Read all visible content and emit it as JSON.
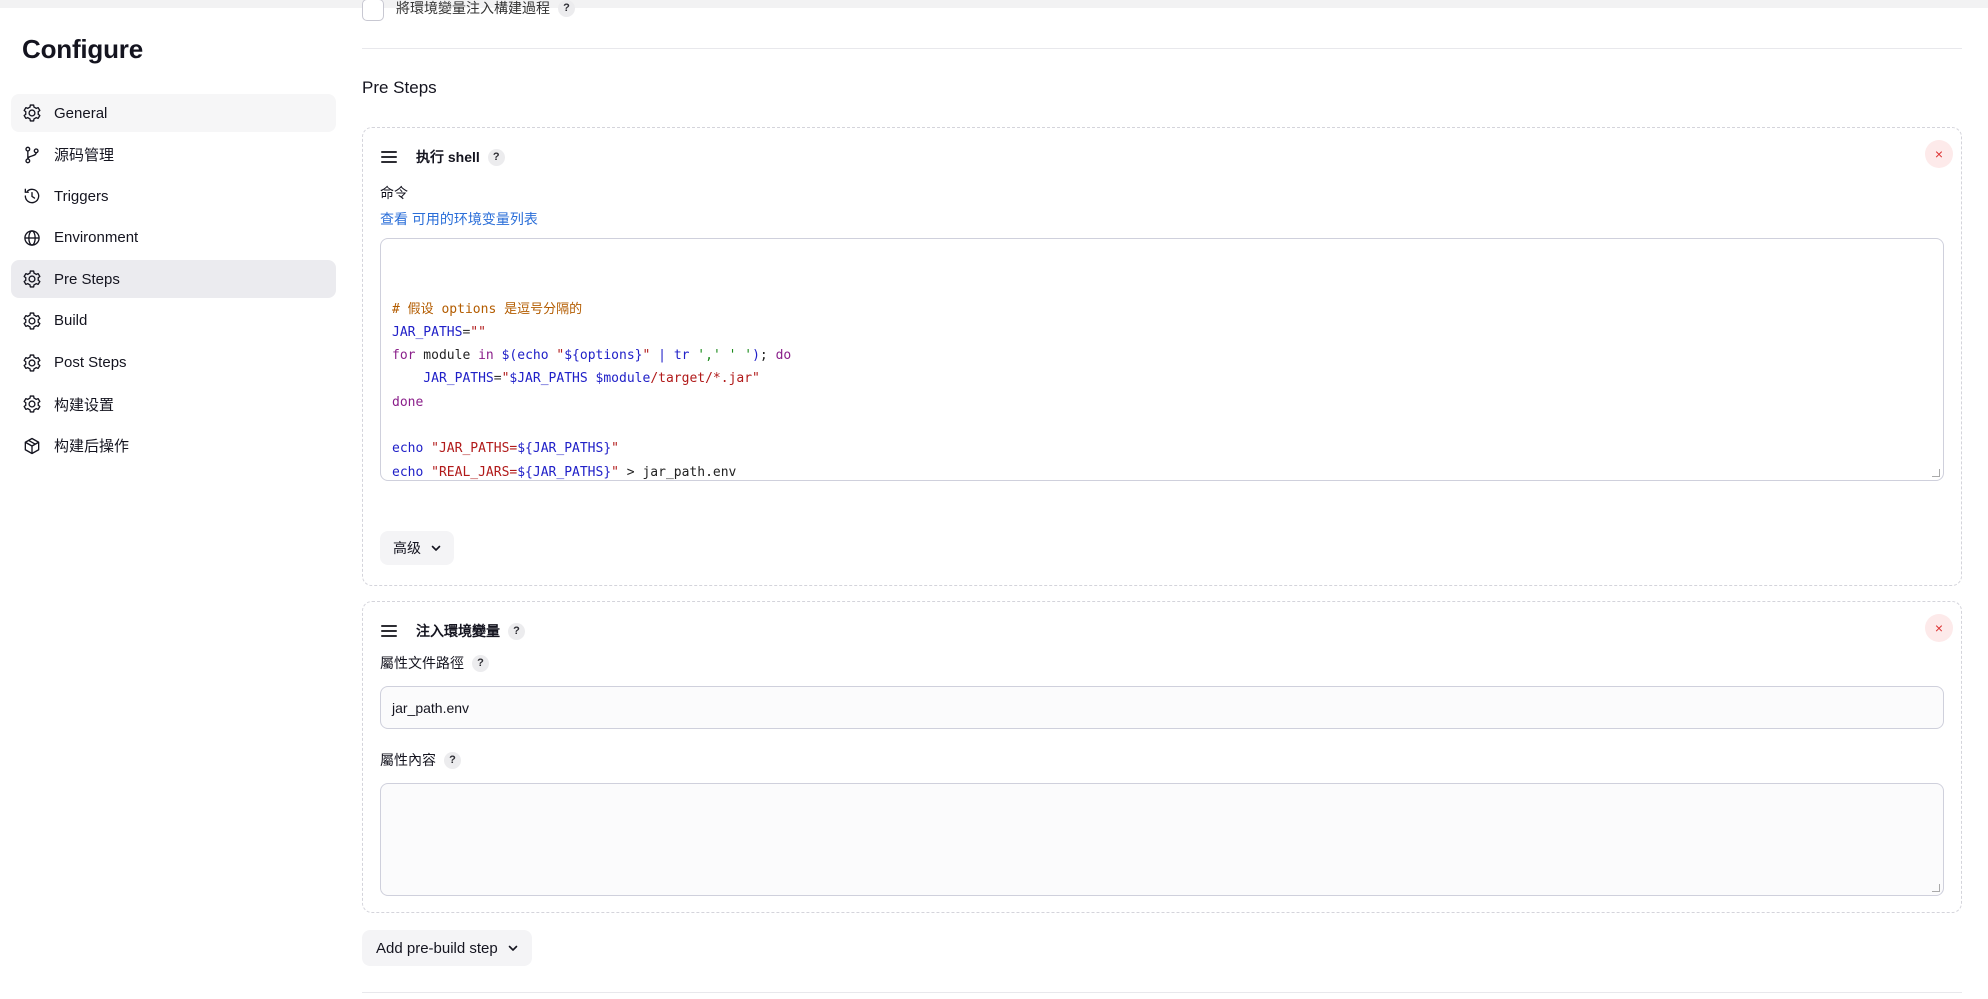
{
  "page": {
    "title": "Configure"
  },
  "sidebar": {
    "items": [
      {
        "label": "General",
        "icon": "gear-icon",
        "state": "hovered"
      },
      {
        "label": "源码管理",
        "icon": "source-branch-icon",
        "state": ""
      },
      {
        "label": "Triggers",
        "icon": "clock-icon",
        "state": ""
      },
      {
        "label": "Environment",
        "icon": "globe-icon",
        "state": ""
      },
      {
        "label": "Pre Steps",
        "icon": "gear-icon",
        "state": "active"
      },
      {
        "label": "Build",
        "icon": "gear-icon",
        "state": ""
      },
      {
        "label": "Post Steps",
        "icon": "gear-icon",
        "state": ""
      },
      {
        "label": "构建设置",
        "icon": "gear-icon",
        "state": ""
      },
      {
        "label": "构建后操作",
        "icon": "package-icon",
        "state": ""
      }
    ]
  },
  "top_option": {
    "label": "將環境變量注入構建過程",
    "help": "?"
  },
  "section": {
    "title": "Pre Steps"
  },
  "step1": {
    "title": "执行 shell",
    "help": "?",
    "close": "×",
    "command_label": "命令",
    "link_prefix": "查看 ",
    "link_text": "可用的环境变量列表",
    "code_lines": [
      [
        {
          "t": "# 假设 options 是逗号分隔的",
          "c": "#b35c00"
        }
      ],
      [
        {
          "t": "JAR_PATHS",
          "c": "#2020c8"
        },
        {
          "t": "=",
          "c": "#333"
        },
        {
          "t": "\"\"",
          "c": "#b11a1a"
        }
      ],
      [
        {
          "t": "for",
          "c": "#8a1f8a"
        },
        {
          "t": " module ",
          "c": "#222"
        },
        {
          "t": "in",
          "c": "#8a1f8a"
        },
        {
          "t": " ",
          "c": "#222"
        },
        {
          "t": "$(",
          "c": "#2020c8"
        },
        {
          "t": "echo ",
          "c": "#2020c8"
        },
        {
          "t": "\"",
          "c": "#b11a1a"
        },
        {
          "t": "${options}",
          "c": "#2020c8"
        },
        {
          "t": "\"",
          "c": "#b11a1a"
        },
        {
          "t": " | ",
          "c": "#2020c8"
        },
        {
          "t": "tr ",
          "c": "#2020c8"
        },
        {
          "t": "','",
          "c": "#1b8a1b"
        },
        {
          "t": " ",
          "c": "#222"
        },
        {
          "t": "' '",
          "c": "#1b8a1b"
        },
        {
          "t": ")",
          "c": "#2020c8"
        },
        {
          "t": "; ",
          "c": "#222"
        },
        {
          "t": "do",
          "c": "#8a1f8a"
        }
      ],
      [
        {
          "t": "    JAR_PATHS",
          "c": "#2020c8"
        },
        {
          "t": "=",
          "c": "#333"
        },
        {
          "t": "\"",
          "c": "#b11a1a"
        },
        {
          "t": "$JAR_PATHS",
          "c": "#2020c8"
        },
        {
          "t": " ",
          "c": "#b11a1a"
        },
        {
          "t": "$module",
          "c": "#2020c8"
        },
        {
          "t": "/target/*.jar\"",
          "c": "#b11a1a"
        }
      ],
      [
        {
          "t": "done",
          "c": "#8a1f8a"
        }
      ],
      [],
      [
        {
          "t": "echo ",
          "c": "#2020c8"
        },
        {
          "t": "\"JAR_PATHS=",
          "c": "#b11a1a"
        },
        {
          "t": "${JAR_PATHS}",
          "c": "#2020c8"
        },
        {
          "t": "\"",
          "c": "#b11a1a"
        }
      ],
      [
        {
          "t": "echo ",
          "c": "#2020c8"
        },
        {
          "t": "\"REAL_JARS=",
          "c": "#b11a1a"
        },
        {
          "t": "${JAR_PATHS}",
          "c": "#2020c8"
        },
        {
          "t": "\"",
          "c": "#b11a1a"
        },
        {
          "t": " > jar_path.env",
          "c": "#222"
        }
      ]
    ],
    "advanced_label": "高级"
  },
  "step2": {
    "title": "注入環境變量",
    "help": "?",
    "close": "×",
    "file_label": "屬性文件路徑",
    "file_help": "?",
    "file_value": "jar_path.env",
    "content_label": "屬性內容",
    "content_help": "?",
    "content_value": ""
  },
  "add_step": {
    "label": "Add pre-build step"
  }
}
